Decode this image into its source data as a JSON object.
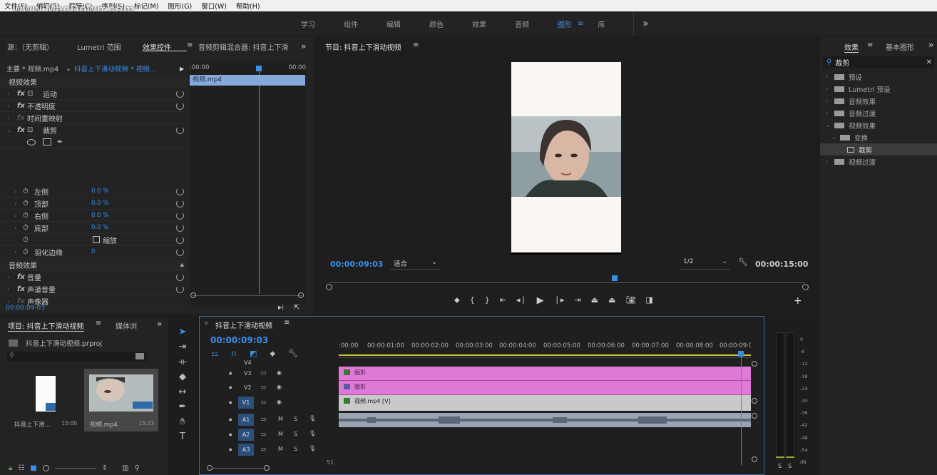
{
  "watermark": "www.MacDown.com",
  "menu": [
    "文件(F)",
    "编辑(E)",
    "剪辑(C)",
    "序列(S)",
    "标记(M)",
    "图形(G)",
    "窗口(W)",
    "帮助(H)"
  ],
  "workspaces": [
    "学习",
    "组件",
    "编辑",
    "颜色",
    "效果",
    "音频",
    "图形",
    "库"
  ],
  "workspace_active": "图形",
  "more": "»",
  "source_panel": {
    "tabs": [
      "源：（无剪辑）",
      "Lumetri 范围",
      "效果控件",
      "音频剪辑混合器: 抖音上下滑"
    ],
    "active_tab": "效果控件",
    "master": "主要 * 视频.mp4",
    "sequence": "抖音上下滑动视频 * 视频...",
    "ruler_start": ":00:00",
    "ruler_end": "00:00",
    "clip": "视频.mp4",
    "video_effects": "视频效果",
    "effects": [
      "运动",
      "不透明度",
      "时间重映射",
      "裁剪"
    ],
    "crop_params": [
      {
        "name": "左侧",
        "value": "0.0 %"
      },
      {
        "name": "顶部",
        "value": "0.0 %"
      },
      {
        "name": "右侧",
        "value": "0.0 %"
      },
      {
        "name": "底部",
        "value": "0.0 %"
      }
    ],
    "zoom_label": "缩放",
    "feather_label": "羽化边缘",
    "feather_value": "0",
    "audio_effects": "音频效果",
    "audio_items": [
      "音量",
      "声道音量",
      "声像器"
    ],
    "timecode": "00:00:09:03"
  },
  "program": {
    "title": "节目: 抖音上下滑动视频",
    "timecode": "00:00:09:03",
    "fit": "适合",
    "resolution": "1/2",
    "duration": "00:00:15:00",
    "playhead_fraction": 0.6
  },
  "project": {
    "title": "项目: 抖音上下滑动视频",
    "tab2": "媒体浏",
    "file": "抖音上下滑动视频.prproj",
    "items": [
      {
        "name": "抖音上下滑...",
        "duration": "15:00"
      },
      {
        "name": "视频.mp4",
        "duration": "15:23"
      }
    ]
  },
  "timeline": {
    "title": "抖音上下滑动视频",
    "timecode": "00:00:09:03",
    "ruler": [
      ":00:00",
      "00:00:01:00",
      "00:00:02:00",
      "00:00:03:00",
      "00:00:04:00",
      "00:00:05:00",
      "00:00:06:00",
      "00:00:07:00",
      "00:00:08:00",
      "00:00:09:0("
    ],
    "video_tracks": [
      "V4",
      "V3",
      "V2",
      "V1"
    ],
    "audio_tracks": [
      "A1",
      "A2",
      "A3"
    ],
    "clip_v3": "图形",
    "clip_v2": "图形",
    "clip_v1": "视频.mp4 [V]",
    "track_btn_m": "M",
    "track_btn_s": "S",
    "counter": "51"
  },
  "effects_panel": {
    "tabs": [
      "效果",
      "基本图形"
    ],
    "search": "裁剪",
    "tree": [
      "预设",
      "Lumetri 预设",
      "音频效果",
      "音频过渡",
      "视频效果",
      "变换",
      "裁剪",
      "视频过渡"
    ]
  },
  "meter": {
    "scale": [
      "0",
      "-6",
      "-12",
      "-18",
      "-24",
      "-30",
      "-36",
      "-42",
      "-48",
      "-54",
      "dB"
    ],
    "s": "S"
  },
  "colors": {
    "graphic_clip": "#e07ad8",
    "accent": "#2d8ceb",
    "video_clip": "#c9c9c9"
  }
}
